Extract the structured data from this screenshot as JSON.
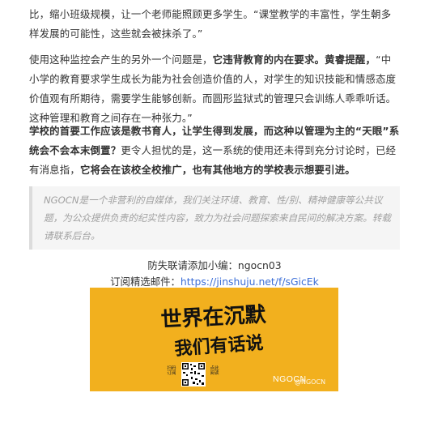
{
  "article": {
    "p1": "比，缩小班级规模，让一个老师能照顾更多学生。“课堂教学的丰富性，学生朝多样发展的可能性，这些就会被抹杀了。”",
    "p2_a": "使用这种监控会产生的另外一个问题是，",
    "p2_bold1": "它违背教育的内在要求。",
    "p2_bold2": "黄睿提醒，",
    "p2_b": "“中小学的教育要求学生成长为能为社会创造价值的人，对学生的知识技能和情感态度价值观有所期待，需要学生能够创新。而圆形监狱式的管理只会训练人乖乖听话。这种管理和教育之间存在一种张力。”",
    "p3_bold1": "学校的首要工作应该是教书育人，让学生得到发展，而这种以管理为主的“天眼”系统会不会本末倒置？",
    "p3_a": "更令人担忧的是，这一系统的使用还未得到充分讨论时，已经有消息指，",
    "p3_bold2": "它将会在该校全校推广，也有其他地方的学校表示想要引进。"
  },
  "quote": {
    "text": "NGOCN是一个非营利的自媒体，我们关注环境、教育、性/别、精神健康等公共议题，为公众提供负责的纪实性内容，致力为社会问题探索来自民间的解决方案。转载请联系后台。"
  },
  "contact": {
    "line1": "防失联请添加小编：ngocn03",
    "line2_label": "订阅精选邮件：",
    "line2_link": "https://jinshuju.net/f/sGicEk"
  },
  "banner": {
    "title_line1": "世界在沉默",
    "title_line2": "我们有话说",
    "scan_left": "扫码订阅",
    "scan_right": "点此阅读",
    "brand": "NGOCN",
    "watermark": "@NGOCN",
    "background_color": "#f2b01e"
  }
}
